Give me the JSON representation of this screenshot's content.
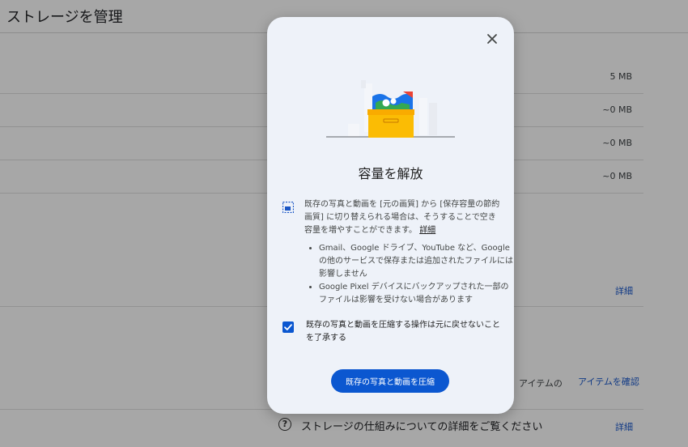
{
  "page": {
    "title": "ストレージを管理",
    "sizes": [
      "5 MB",
      "~0 MB",
      "~0 MB",
      "~0 MB"
    ],
    "learn_more_1": "詳細",
    "items_text": "アイテムの",
    "review_items": "アイテムを確認",
    "help_icon": "help-circle-icon",
    "help_text": "ストレージの仕組みについての詳細をご覧ください",
    "learn_more_2": "詳細"
  },
  "dialog": {
    "close_icon": "close-icon",
    "illustration": "storage-box-illustration",
    "title": "容量を解放",
    "hd_icon": "hd-quality-icon",
    "description": "既存の写真と動画を [元の画質] から [保存容量の節約画質] に切り替えられる場合は、そうすることで空き容量を増やすことができます。",
    "details_link": "詳細",
    "bullets": [
      "Gmail、Google ドライブ、YouTube など、Google の他のサービスで保存または追加されたファイルには影響しません",
      "Google Pixel デバイスにバックアップされた一部のファイルは影響を受けない場合があります"
    ],
    "checkbox_label": "既存の写真と動画を圧縮する操作は元に戻せないことを了承する",
    "checkbox_checked": true,
    "primary_button": "既存の写真と動画を圧縮"
  },
  "colors": {
    "accent": "#0b57d0",
    "dialog_bg": "#eef2f9",
    "box_yellow": "#fbbc04"
  }
}
